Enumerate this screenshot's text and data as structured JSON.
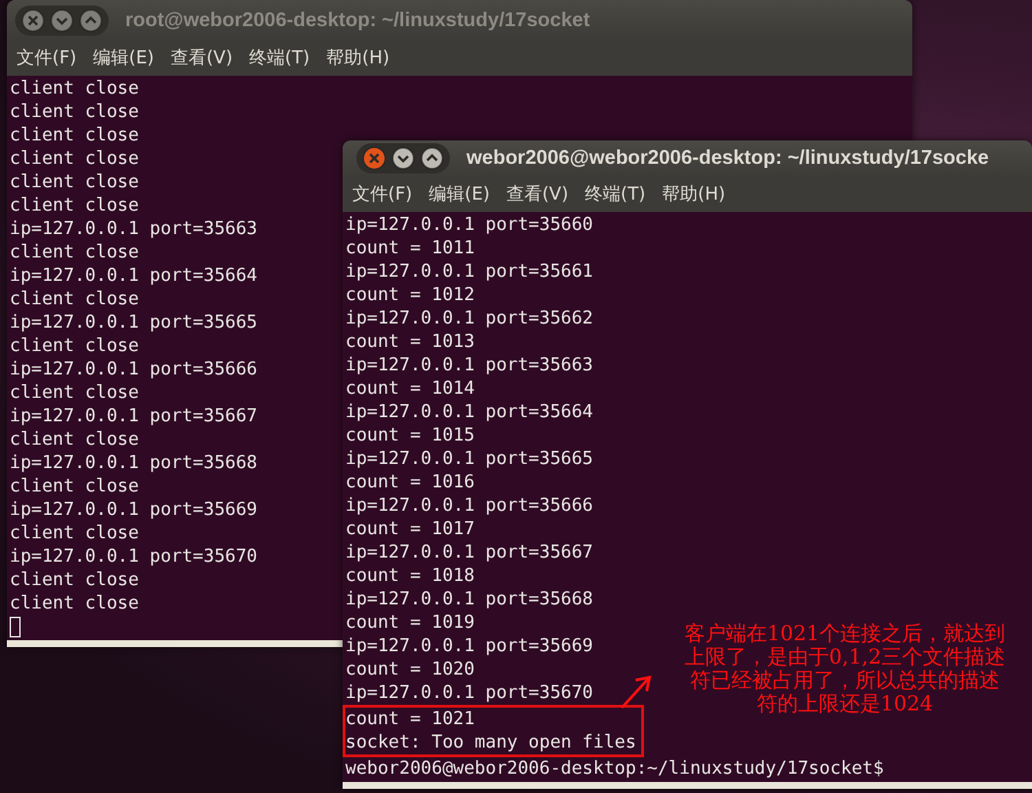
{
  "windows": [
    {
      "title": "root@webor2006-desktop: ~/linuxstudy/17socket",
      "active": false,
      "cursor": true,
      "menu": [
        "文件(F)",
        "编辑(E)",
        "查看(V)",
        "终端(T)",
        "帮助(H)"
      ],
      "lines": [
        {
          "text": "client close",
          "highlighted": false
        },
        {
          "text": "client close",
          "highlighted": false
        },
        {
          "text": "client close",
          "highlighted": false
        },
        {
          "text": "client close",
          "highlighted": false
        },
        {
          "text": "client close",
          "highlighted": false
        },
        {
          "text": "client close",
          "highlighted": false
        },
        {
          "text": "ip=127.0.0.1 port=35663",
          "highlighted": false
        },
        {
          "text": "client close",
          "highlighted": false
        },
        {
          "text": "ip=127.0.0.1 port=35664",
          "highlighted": false
        },
        {
          "text": "client close",
          "highlighted": false
        },
        {
          "text": "ip=127.0.0.1 port=35665",
          "highlighted": false
        },
        {
          "text": "client close",
          "highlighted": false
        },
        {
          "text": "ip=127.0.0.1 port=35666",
          "highlighted": false
        },
        {
          "text": "client close",
          "highlighted": false
        },
        {
          "text": "ip=127.0.0.1 port=35667",
          "highlighted": false
        },
        {
          "text": "client close",
          "highlighted": false
        },
        {
          "text": "ip=127.0.0.1 port=35668",
          "highlighted": false
        },
        {
          "text": "client close",
          "highlighted": false
        },
        {
          "text": "ip=127.0.0.1 port=35669",
          "highlighted": false
        },
        {
          "text": "client close",
          "highlighted": false
        },
        {
          "text": "ip=127.0.0.1 port=35670",
          "highlighted": false
        },
        {
          "text": "client close",
          "highlighted": false
        },
        {
          "text": "client close",
          "highlighted": false
        }
      ]
    },
    {
      "title": "webor2006@webor2006-desktop: ~/linuxstudy/17socke",
      "active": true,
      "menu": [
        "文件(F)",
        "编辑(E)",
        "查看(V)",
        "终端(T)",
        "帮助(H)"
      ],
      "lines": [
        {
          "text": "ip=127.0.0.1 port=35660",
          "highlighted": false
        },
        {
          "text": "count = 1011",
          "highlighted": false
        },
        {
          "text": "ip=127.0.0.1 port=35661",
          "highlighted": false
        },
        {
          "text": "count = 1012",
          "highlighted": false
        },
        {
          "text": "ip=127.0.0.1 port=35662",
          "highlighted": false
        },
        {
          "text": "count = 1013",
          "highlighted": false
        },
        {
          "text": "ip=127.0.0.1 port=35663",
          "highlighted": false
        },
        {
          "text": "count = 1014",
          "highlighted": false
        },
        {
          "text": "ip=127.0.0.1 port=35664",
          "highlighted": false
        },
        {
          "text": "count = 1015",
          "highlighted": false
        },
        {
          "text": "ip=127.0.0.1 port=35665",
          "highlighted": false
        },
        {
          "text": "count = 1016",
          "highlighted": false
        },
        {
          "text": "ip=127.0.0.1 port=35666",
          "highlighted": false
        },
        {
          "text": "count = 1017",
          "highlighted": false
        },
        {
          "text": "ip=127.0.0.1 port=35667",
          "highlighted": false
        },
        {
          "text": "count = 1018",
          "highlighted": false
        },
        {
          "text": "ip=127.0.0.1 port=35668",
          "highlighted": false
        },
        {
          "text": "count = 1019",
          "highlighted": false
        },
        {
          "text": "ip=127.0.0.1 port=35669",
          "highlighted": false
        },
        {
          "text": "count = 1020",
          "highlighted": false
        },
        {
          "text": "ip=127.0.0.1 port=35670",
          "highlighted": false
        },
        {
          "text": "count = 1021",
          "highlighted": true
        },
        {
          "text": "socket: Too many open files",
          "highlighted": true
        },
        {
          "text": "webor2006@webor2006-desktop:~/linuxstudy/17socket$",
          "highlighted": false
        }
      ]
    }
  ],
  "annotation": {
    "lines": [
      "客户端在1021个连接之后，就达到",
      "上限了，是由于0,1,2三个文件描述",
      "符已经被占用了，所以总共的描述",
      "符的上限还是1024"
    ]
  }
}
